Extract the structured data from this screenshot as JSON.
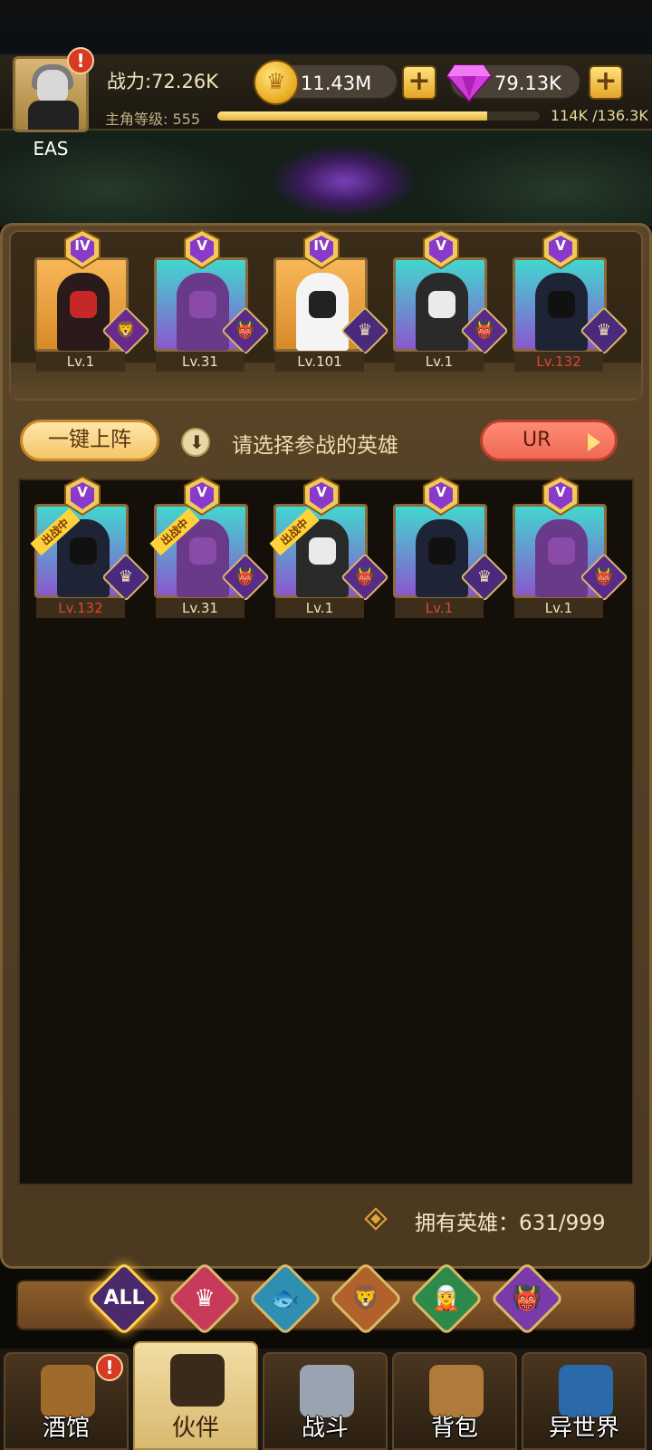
{
  "player": {
    "name": "EAS",
    "power": "战力:72.26K",
    "level_label": "主角等级: 555",
    "exp_text": "114K /136.3K",
    "exp_fraction": 0.836
  },
  "currencies": {
    "gold": "11.43M",
    "gems": "79.13K"
  },
  "team": [
    {
      "rank": "IV",
      "level": "Lv.1",
      "bg": "gold",
      "faction": "lion",
      "level_red": false,
      "fig": "#2a1a1a",
      "face": "#c42828"
    },
    {
      "rank": "V",
      "level": "Lv.31",
      "bg": "cyan",
      "faction": "demon",
      "level_red": false,
      "fig": "#6a3a8a",
      "face": "#8a4aa8"
    },
    {
      "rank": "IV",
      "level": "Lv.101",
      "bg": "gold",
      "faction": "angel",
      "level_red": false,
      "fig": "#f4f4f4",
      "face": "#222"
    },
    {
      "rank": "V",
      "level": "Lv.1",
      "bg": "cyan",
      "faction": "demon",
      "level_red": false,
      "fig": "#2a2a2a",
      "face": "#eaeaea"
    },
    {
      "rank": "V",
      "level": "Lv.132",
      "bg": "cyan",
      "faction": "angel",
      "level_red": true,
      "fig": "#1e2436",
      "face": "#111"
    }
  ],
  "actions": {
    "auto_deploy": "一键上阵",
    "hint": "请选择参战的英雄",
    "rarity_filter": "UR"
  },
  "heroes": [
    {
      "rank": "V",
      "level": "Lv.132",
      "faction": "angel",
      "deployed": true,
      "level_red": true,
      "fig": "#1e2436",
      "face": "#111"
    },
    {
      "rank": "V",
      "level": "Lv.31",
      "faction": "demon",
      "deployed": true,
      "level_red": false,
      "fig": "#6a3a8a",
      "face": "#8a4aa8"
    },
    {
      "rank": "V",
      "level": "Lv.1",
      "faction": "demon",
      "deployed": true,
      "level_red": false,
      "fig": "#2a2a2a",
      "face": "#eaeaea"
    },
    {
      "rank": "V",
      "level": "Lv.1",
      "faction": "angel",
      "deployed": false,
      "level_red": true,
      "fig": "#1e2436",
      "face": "#111"
    },
    {
      "rank": "V",
      "level": "Lv.1",
      "faction": "demon",
      "deployed": false,
      "level_red": false,
      "fig": "#6a3a8a",
      "face": "#8a4aa8"
    }
  ],
  "deployed_ribbon": "出战中",
  "owned_heroes": "拥有英雄：631/999",
  "filters": [
    {
      "label": "ALL",
      "icon": "all-icon",
      "color": "#4a2a6a",
      "active": true
    },
    {
      "label": "♛",
      "icon": "angel-faction-icon",
      "color": "#c83a5a",
      "active": false
    },
    {
      "label": "🐟",
      "icon": "fish-faction-icon",
      "color": "#2f8fb0",
      "active": false
    },
    {
      "label": "🦁",
      "icon": "lion-faction-icon",
      "color": "#b0622a",
      "active": false
    },
    {
      "label": "🧝",
      "icon": "elf-faction-icon",
      "color": "#2e8a4a",
      "active": false
    },
    {
      "label": "👹",
      "icon": "demon-faction-icon",
      "color": "#7a3aa8",
      "active": false
    }
  ],
  "nav": [
    {
      "label": "酒馆",
      "icon": "tavern-mug-icon",
      "active": false,
      "alert": true,
      "color": "#a06a2a"
    },
    {
      "label": "伙伴",
      "icon": "partner-portrait-icon",
      "active": true,
      "alert": false,
      "color": "#3a2a1a"
    },
    {
      "label": "战斗",
      "icon": "crossed-swords-icon",
      "active": false,
      "alert": false,
      "color": "#9aa4b0"
    },
    {
      "label": "背包",
      "icon": "backpack-chest-icon",
      "active": false,
      "alert": false,
      "color": "#b07a3a"
    },
    {
      "label": "异世界",
      "icon": "portal-icon",
      "active": false,
      "alert": false,
      "color": "#2a6aa8"
    }
  ],
  "colors": {
    "accent_gold": "#e4b53a",
    "level_red": "#e04632",
    "alert_red": "#d63a22"
  }
}
